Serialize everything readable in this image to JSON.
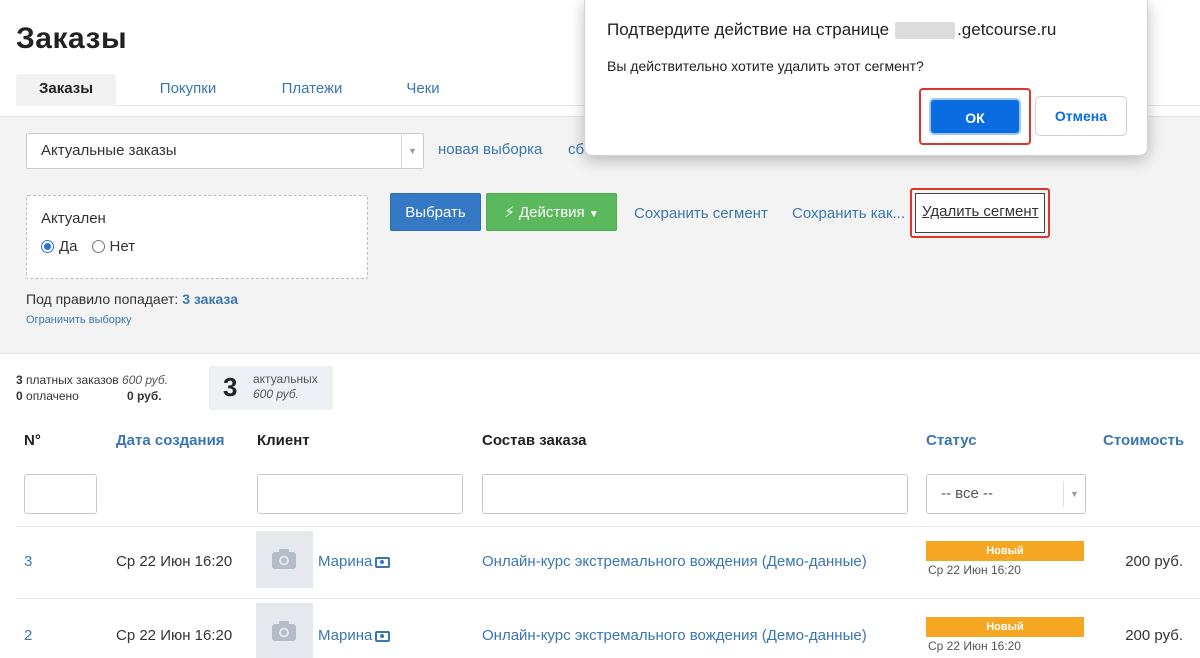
{
  "page_title": "Заказы",
  "tabs": [
    {
      "label": "Заказы",
      "active": true
    },
    {
      "label": "Покупки",
      "active": false
    },
    {
      "label": "Платежи",
      "active": false
    },
    {
      "label": "Чеки",
      "active": false
    }
  ],
  "filter": {
    "segment_select": "Актуальные заказы",
    "new_selection_link": "новая выборка",
    "reset_link_fragment": "сб",
    "condition_title": "Актуален",
    "radio_yes": "Да",
    "radio_no": "Нет",
    "radio_selected": "Да",
    "select_button": "Выбрать",
    "actions_button": "Действия",
    "save_segment_link": "Сохранить сегмент",
    "save_as_link": "Сохранить как...",
    "delete_segment_link": "Удалить сегмент",
    "rule_prefix": "Под правило попадает:",
    "rule_count": "3 заказа",
    "limit_link": "Ограничить выборку"
  },
  "stats": {
    "paid_count": "3",
    "paid_label": "платных заказов",
    "paid_sum": "600 руб.",
    "paid_done_count": "0",
    "paid_done_label": "оплачено",
    "paid_done_sum": "0 руб.",
    "actual_count": "3",
    "actual_label": "актуальных",
    "actual_sum": "600 руб."
  },
  "table": {
    "headers": {
      "num": "N°",
      "created": "Дата создания",
      "client": "Клиент",
      "content": "Состав заказа",
      "status": "Статус",
      "cost": "Стоимость"
    },
    "status_filter": "-- все --",
    "rows": [
      {
        "num": "3",
        "date": "Ср 22 Июн 16:20",
        "client": "Марина",
        "content": "Онлайн-курс экстремального вождения (Демо-данные)",
        "status": "Новый",
        "status_date": "Ср 22 Июн 16:20",
        "cost": "200 руб."
      },
      {
        "num": "2",
        "date": "Ср 22 Июн 16:20",
        "client": "Марина",
        "content": "Онлайн-курс экстремального вождения (Демо-данные)",
        "status": "Новый",
        "status_date": "Ср 22 Июн 16:20",
        "cost": "200 руб."
      }
    ]
  },
  "dialog": {
    "title_prefix": "Подтвердите действие на странице",
    "title_domain": ".getcourse.ru",
    "message": "Вы действительно хотите удалить этот сегмент?",
    "ok_button": "ОК",
    "cancel_button": "Отмена"
  },
  "colors": {
    "link": "#3a76b0",
    "primary": "#3578c4",
    "success": "#5cb85c",
    "status_new": "#f5a623",
    "highlight": "#d9362e",
    "dialog_ok": "#0b6be0"
  }
}
